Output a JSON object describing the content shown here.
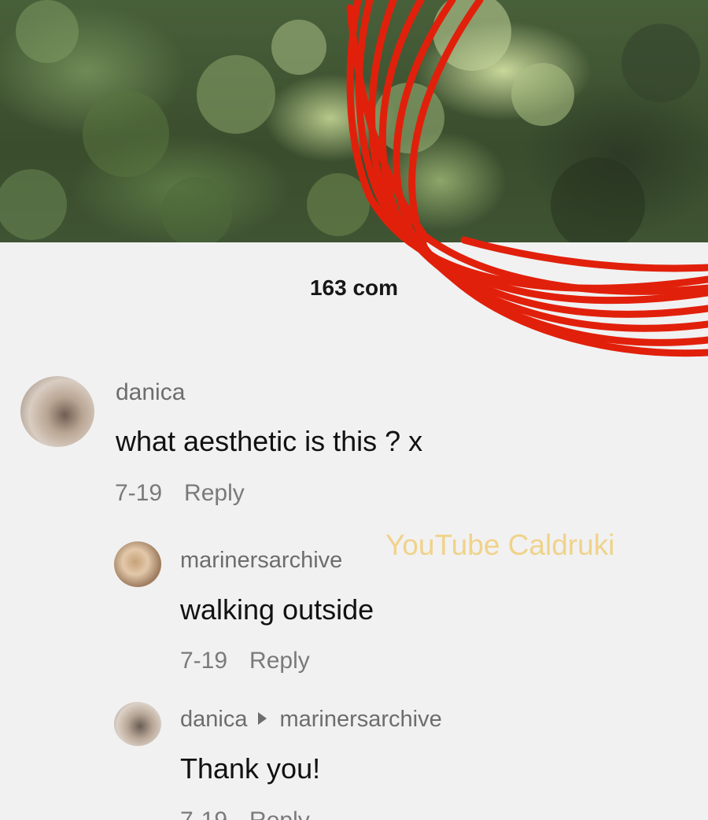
{
  "comments_panel": {
    "count_label": "163 com"
  },
  "comments": [
    {
      "username": "danica",
      "text": "what aesthetic is this ? x",
      "date": "7-19",
      "reply_label": "Reply"
    }
  ],
  "replies": [
    {
      "username": "marinersarchive",
      "text": "walking outside",
      "date": "7-19",
      "reply_label": "Reply"
    },
    {
      "username": "danica",
      "reply_to": "marinersarchive",
      "text": "Thank you!",
      "date": "7-19",
      "reply_label": "Reply"
    }
  ],
  "watermark": "YouTube Caldruki",
  "colors": {
    "scribble": "#e1200b",
    "watermark": "#f0d28a",
    "panel_background": "#f1f1f1"
  },
  "icons": {
    "reply_to_arrow": "caret-right-icon"
  }
}
